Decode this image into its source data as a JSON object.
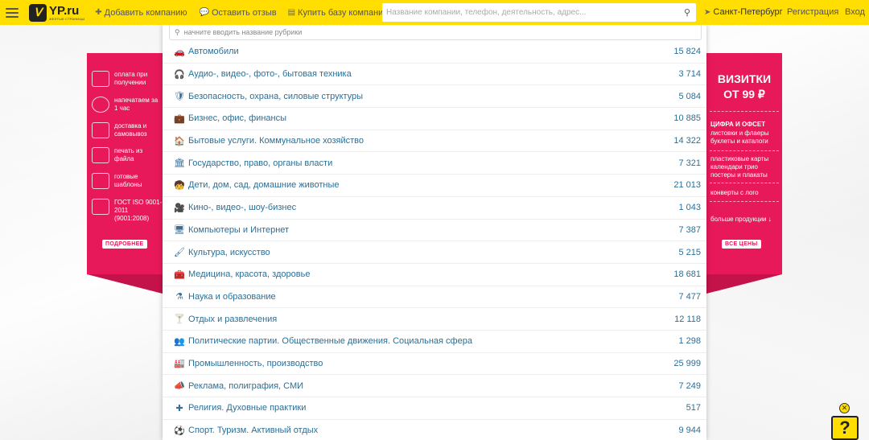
{
  "header": {
    "logo_big": "YP.ru",
    "logo_small": "ЖЕЛТЫЕ СТРАНИЦЫ",
    "add_company": "Добавить компанию",
    "leave_review": "Оставить отзыв",
    "buy_base": "Купить базу компаний",
    "search_placeholder": "Название компании, телефон, деятельность, адрес...",
    "city": "Санкт-Петербург",
    "register": "Регистрация",
    "login": "Вход"
  },
  "rubric_search": {
    "placeholder": "начните вводить название рубрики"
  },
  "rubrics": [
    {
      "icon": "car-icon",
      "glyph": "🚗",
      "name": "Автомобили",
      "count": "15 824"
    },
    {
      "icon": "headphones-icon",
      "glyph": "🎧",
      "name": "Аудио-, видео-, фото-, бытовая техника",
      "count": "3 714"
    },
    {
      "icon": "shield-icon",
      "glyph": "🛡",
      "name": "Безопасность, охрана, силовые структуры",
      "count": "5 084"
    },
    {
      "icon": "briefcase-icon",
      "glyph": "💼",
      "name": "Бизнес, офис, финансы",
      "count": "10 885"
    },
    {
      "icon": "home-icon",
      "glyph": "🏠",
      "name": "Бытовые услуги. Коммунальное хозяйство",
      "count": "14 322"
    },
    {
      "icon": "building-icon",
      "glyph": "🏛",
      "name": "Государство, право, органы власти",
      "count": "7 321"
    },
    {
      "icon": "child-icon",
      "glyph": "🧒",
      "name": "Дети, дом, сад, домашние животные",
      "count": "21 013"
    },
    {
      "icon": "video-camera-icon",
      "glyph": "🎥",
      "name": "Кино-, видео-, шоу-бизнес",
      "count": "1 043"
    },
    {
      "icon": "monitor-icon",
      "glyph": "🖥",
      "name": "Компьютеры и Интернет",
      "count": "7 387"
    },
    {
      "icon": "brush-icon",
      "glyph": "🖌",
      "name": "Культура, искусство",
      "count": "5 215"
    },
    {
      "icon": "medkit-icon",
      "glyph": "🧰",
      "name": "Медицина, красота, здоровье",
      "count": "18 681"
    },
    {
      "icon": "flask-icon",
      "glyph": "⚗",
      "name": "Наука и образование",
      "count": "7 477"
    },
    {
      "icon": "cocktail-icon",
      "glyph": "🍸",
      "name": "Отдых и развлечения",
      "count": "12 118"
    },
    {
      "icon": "group-icon",
      "glyph": "👥",
      "name": "Политические партии. Общественные движения. Социальная сфера",
      "count": "1 298"
    },
    {
      "icon": "factory-icon",
      "glyph": "🏭",
      "name": "Промышленность, производство",
      "count": "25 999"
    },
    {
      "icon": "megaphone-icon",
      "glyph": "📣",
      "name": "Реклама, полиграфия, СМИ",
      "count": "7 249"
    },
    {
      "icon": "cross-icon",
      "glyph": "✚",
      "name": "Религия. Духовные практики",
      "count": "517"
    },
    {
      "icon": "football-icon",
      "glyph": "⚽",
      "name": "Спорт. Туризм. Активный отдых",
      "count": "9 944"
    }
  ],
  "promo_left": {
    "items": [
      {
        "text": "оплата при получении"
      },
      {
        "text": "напечатаем за 1 час"
      },
      {
        "text": "доставка и самовывоз"
      },
      {
        "text": "печать из файла"
      },
      {
        "text": "готовые шаблоны"
      },
      {
        "text": "ГОСТ ISO 9001-2011 (9001:2008)"
      }
    ],
    "button": "ПОДРОБНЕЕ"
  },
  "promo_right": {
    "title_line1": "ВИЗИТКИ",
    "title_line2": "ОТ 99 ₽",
    "subtitle": "ЦИФРА И ОФСЕТ",
    "line1": "листовки и флаеры",
    "line2": "буклеты и каталоги",
    "line3": "пластиковые карты",
    "line4": "календари трио",
    "line5": "постеры и плакаты",
    "line6": "конверты с лого",
    "more": "больше продукции ↓",
    "button": "ВСЕ ЦЕНЫ"
  },
  "help": {
    "close": "✕",
    "button": "?"
  }
}
